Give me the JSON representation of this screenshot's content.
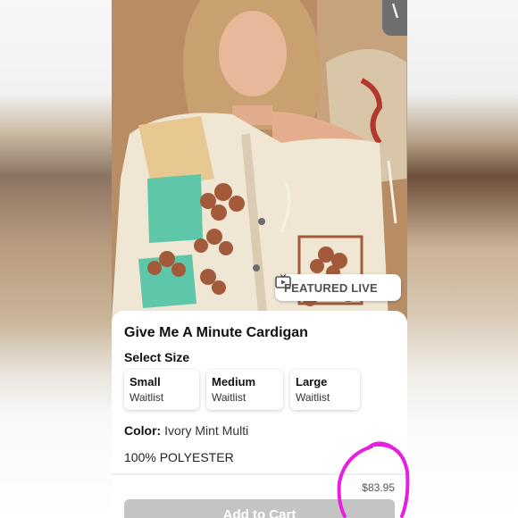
{
  "product": {
    "title": "Give Me A Minute Cardigan",
    "select_size_label": "Select Size",
    "sizes": [
      {
        "name": "Small",
        "status": "Waitlist"
      },
      {
        "name": "Medium",
        "status": "Waitlist"
      },
      {
        "name": "Large",
        "status": "Waitlist"
      }
    ],
    "color_key": "Color:",
    "color_value": "Ivory Mint Multi",
    "material": "100% POLYESTER",
    "price": "$83.95",
    "add_to_cart_label": "Add to Cart"
  },
  "badge": {
    "featured_label": "FEATURED LIVE",
    "icon": "tv-play-icon"
  },
  "colors": {
    "button_disabled": "#c4c4c4",
    "annotation_magenta": "#e81fe0",
    "mint": "#5ec7a9",
    "rust": "#a35a3b"
  }
}
